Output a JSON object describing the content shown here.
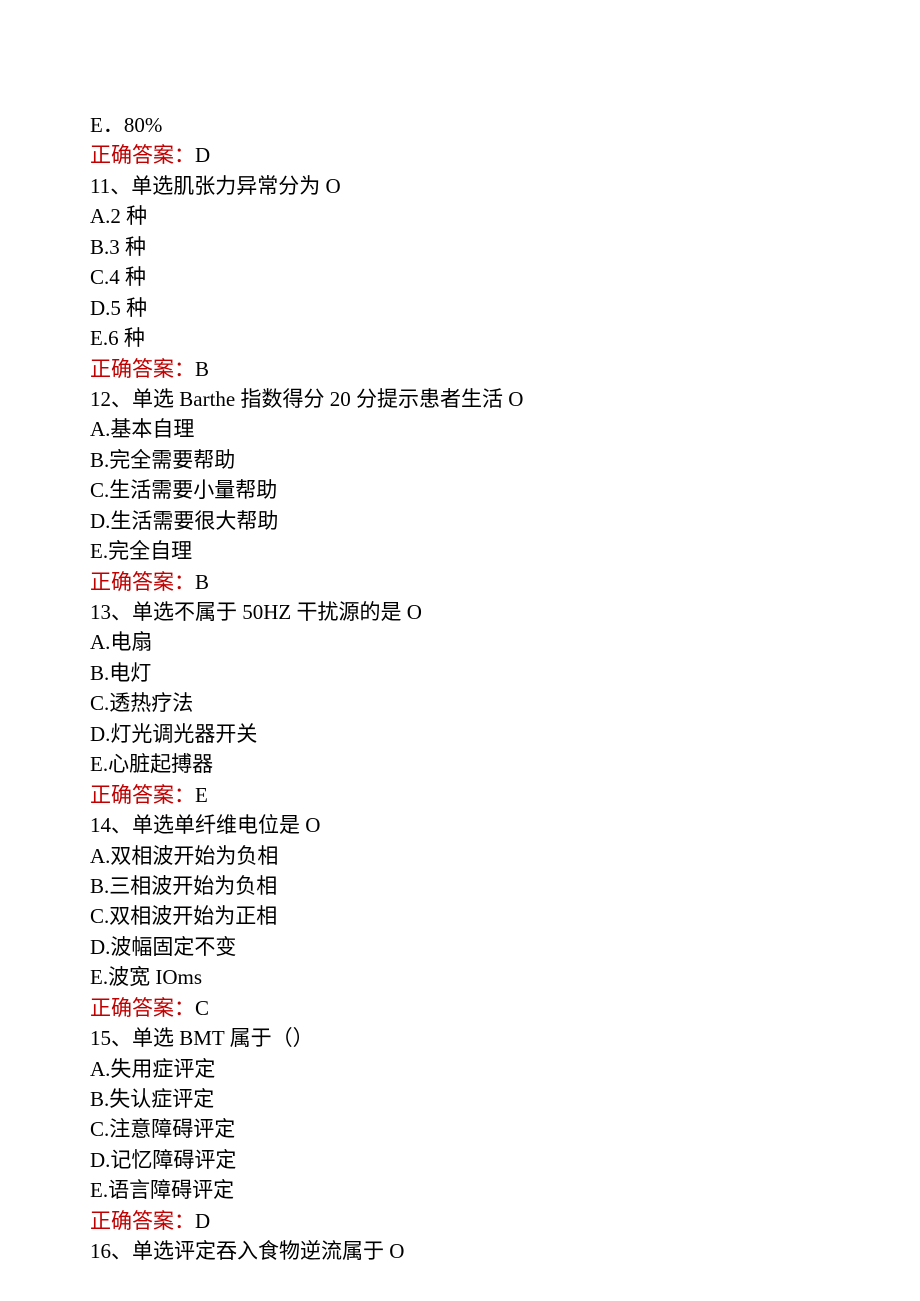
{
  "answer_label": "正确答案：",
  "blocks": [
    {
      "lines": [
        "E．80%"
      ],
      "answer": "D"
    },
    {
      "lines": [
        "11、单选肌张力异常分为 O",
        "A.2 种",
        "B.3 种",
        "C.4 种",
        "D.5 种",
        "E.6 种"
      ],
      "answer": "B"
    },
    {
      "lines": [
        "12、单选 Barthe 指数得分 20 分提示患者生活 O",
        "A.基本自理",
        "B.完全需要帮助",
        "C.生活需要小量帮助",
        "D.生活需要很大帮助",
        "E.完全自理"
      ],
      "answer": "B"
    },
    {
      "lines": [
        "13、单选不属于 50HZ 干扰源的是 O",
        "A.电扇",
        "B.电灯",
        "C.透热疗法",
        "D.灯光调光器开关",
        "E.心脏起搏器"
      ],
      "answer": "E"
    },
    {
      "lines": [
        "14、单选单纤维电位是 O",
        "A.双相波开始为负相",
        "B.三相波开始为负相",
        "C.双相波开始为正相",
        "D.波幅固定不变",
        "E.波宽 IOms"
      ],
      "answer": "C"
    },
    {
      "lines": [
        "15、单选 BMT 属于（）",
        "A.失用症评定",
        "B.失认症评定",
        "C.注意障碍评定",
        "D.记忆障碍评定",
        "E.语言障碍评定"
      ],
      "answer": "D"
    },
    {
      "lines": [
        "16、单选评定吞入食物逆流属于 O"
      ]
    }
  ]
}
